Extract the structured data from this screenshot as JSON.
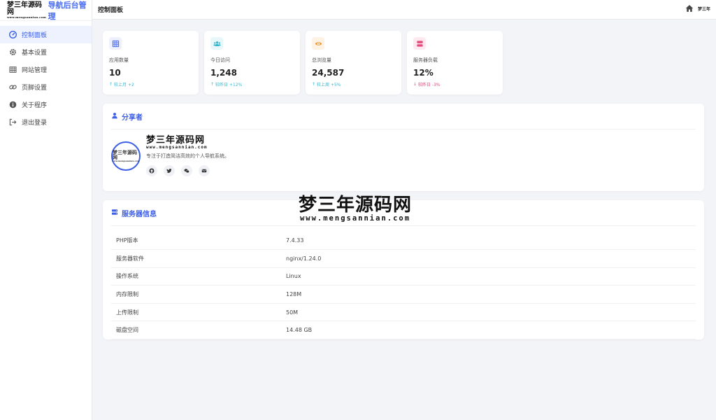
{
  "brand": {
    "logo_text": "梦三年源码网",
    "logo_sub": "www.mengsannian.com",
    "title": "导航后台管理"
  },
  "sidebar": {
    "items": [
      {
        "label": "控制面板",
        "icon": "dashboard-icon",
        "active": true
      },
      {
        "label": "基本设置",
        "icon": "gear-icon"
      },
      {
        "label": "网站管理",
        "icon": "table-icon"
      },
      {
        "label": "页脚设置",
        "icon": "link-icon"
      },
      {
        "label": "关于程序",
        "icon": "info-icon"
      },
      {
        "label": "退出登录",
        "icon": "logout-icon"
      }
    ]
  },
  "header": {
    "title": "控制面板",
    "avatar_text": "梦三年",
    "home_icon": "home-icon"
  },
  "stats": [
    {
      "label": "应用数量",
      "value": "10",
      "trend": "较上月 +2",
      "direction": "up",
      "icon": "grid-icon",
      "color": "#4a6cf0",
      "bg": "#eef1fd"
    },
    {
      "label": "今日访问",
      "value": "1,248",
      "trend": "较昨日 +12%",
      "direction": "up",
      "icon": "users-icon",
      "color": "#35b9cf",
      "bg": "#e8f7fa"
    },
    {
      "label": "总浏览量",
      "value": "24,587",
      "trend": "较上周 +5%",
      "direction": "up",
      "icon": "eye-icon",
      "color": "#f39c2d",
      "bg": "#fdf2e4"
    },
    {
      "label": "服务器负载",
      "value": "12%",
      "trend": "较昨日 -3%",
      "direction": "down",
      "icon": "server-icon",
      "color": "#e64a7b",
      "bg": "#fde9ef"
    }
  ],
  "sharer": {
    "title": "分享者",
    "name": "梦三年源码网",
    "name_sub": "www.mengsannian.com",
    "desc": "专注于打造简洁高效的个人导航系统。",
    "avatar_text": "梦三年源码网",
    "avatar_sub": "www.mengsannian.com",
    "socials": [
      "github-icon",
      "twitter-icon",
      "wechat-icon",
      "mail-icon"
    ]
  },
  "server": {
    "title": "服务器信息",
    "rows": [
      {
        "key": "PHP版本",
        "value": "7.4.33"
      },
      {
        "key": "服务器软件",
        "value": "nginx/1.24.0"
      },
      {
        "key": "操作系统",
        "value": "Linux"
      },
      {
        "key": "内存限制",
        "value": "128M"
      },
      {
        "key": "上传限制",
        "value": "50M"
      },
      {
        "key": "磁盘空间",
        "value": "14.48 GB"
      }
    ]
  },
  "watermark": {
    "main": "梦三年源码网",
    "sub": "www.mengsannian.com"
  }
}
